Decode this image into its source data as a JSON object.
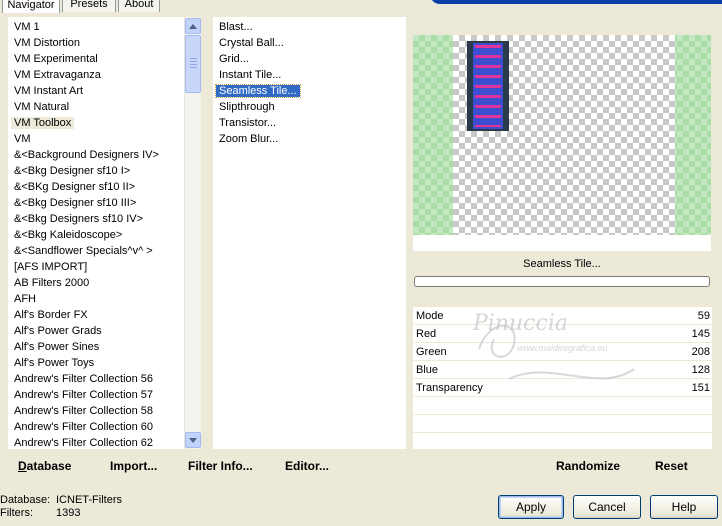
{
  "tabs": [
    "Navigator",
    "Presets",
    "About"
  ],
  "categories": [
    "VM 1",
    "VM Distortion",
    "VM Experimental",
    "VM Extravaganza",
    "VM Instant Art",
    "VM Natural",
    "VM Toolbox",
    "VM",
    "&<Background Designers IV>",
    "&<Bkg Designer sf10 I>",
    "&<BKg Designer sf10 II>",
    "&<Bkg Designer sf10 III>",
    "&<Bkg Designers sf10 IV>",
    "&<Bkg Kaleidoscope>",
    "&<Sandflower Specials^v^ >",
    "[AFS IMPORT]",
    "AB Filters 2000",
    "AFH",
    "Alf's Border FX",
    "Alf's Power Grads",
    "Alf's Power Sines",
    "Alf's Power Toys",
    "Andrew's Filter Collection 56",
    "Andrew's Filter Collection 57",
    "Andrew's Filter Collection 58",
    "Andrew's Filter Collection 60",
    "Andrew's Filter Collection 62"
  ],
  "selected_category": "VM Toolbox",
  "filters": [
    "Blast...",
    "Crystal Ball...",
    "Grid...",
    "Instant Tile...",
    "Seamless Tile...",
    "Slipthrough",
    "Transistor...",
    "Zoom Blur..."
  ],
  "selected_filter": "Seamless Tile...",
  "bottom_links": {
    "database": "Database",
    "import": "Import...",
    "filter_info": "Filter Info...",
    "editor": "Editor..."
  },
  "preview": {
    "filter_label": "Seamless Tile...",
    "progress": 0
  },
  "params": [
    {
      "label": "Mode",
      "value": "59"
    },
    {
      "label": "Red",
      "value": "145"
    },
    {
      "label": "Green",
      "value": "208"
    },
    {
      "label": "Blue",
      "value": "128"
    },
    {
      "label": "Transparency",
      "value": "151"
    }
  ],
  "randomize": "Randomize",
  "reset": "Reset",
  "status": {
    "db_label": "Database:",
    "db_value": "ICNET-Filters",
    "filters_label": "Filters:",
    "filters_value": "1393"
  },
  "buttons": {
    "apply": "Apply",
    "cancel": "Cancel",
    "help": "Help"
  },
  "watermark": {
    "name": "Pinuccia",
    "site": "www.maidiregrafica.eu"
  },
  "colors": {
    "selection_blue": "#316ac5",
    "preview_green": "#a9dca6",
    "tile_dark": "#2a3a4a",
    "tile_blue": "#3b4fd0",
    "tile_magenta": "#e0349a"
  }
}
